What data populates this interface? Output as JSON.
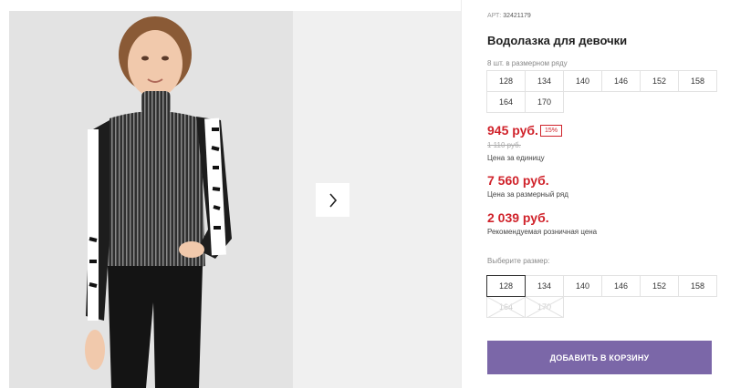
{
  "product": {
    "article_label": "АРТ:",
    "article_number": "32421179",
    "title": "Водолазка для девочки",
    "pack_caption": "8 шт. в размерном ряду",
    "pack_sizes": [
      "128",
      "134",
      "140",
      "146",
      "152",
      "158",
      "164",
      "170"
    ]
  },
  "pricing": {
    "unit_price": "945 руб.",
    "discount": "15%",
    "old_price": "1 110 руб.",
    "unit_label": "Цена за единицу",
    "pack_price": "7 560 руб.",
    "pack_label": "Цена за размерный ряд",
    "retail_price": "2 039 руб.",
    "retail_label": "Рекомендуемая розничная цена"
  },
  "size_select": {
    "caption": "Выберите размер:",
    "options": [
      {
        "label": "128",
        "state": "selected"
      },
      {
        "label": "134",
        "state": "available"
      },
      {
        "label": "140",
        "state": "available"
      },
      {
        "label": "146",
        "state": "available"
      },
      {
        "label": "152",
        "state": "available"
      },
      {
        "label": "158",
        "state": "available"
      },
      {
        "label": "164",
        "state": "unavailable"
      },
      {
        "label": "170",
        "state": "unavailable"
      }
    ]
  },
  "actions": {
    "add_to_cart": "ДОБАВИТЬ В КОРЗИНУ"
  },
  "icons": {
    "next": "chevron-right-icon"
  },
  "colors": {
    "price": "#d0232b",
    "button": "#7b67a8"
  }
}
